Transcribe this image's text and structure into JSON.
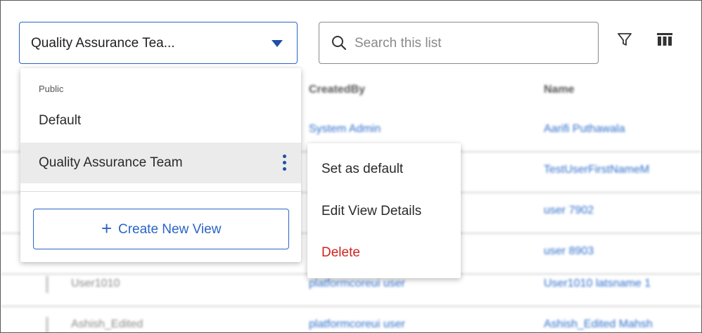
{
  "view_selector": {
    "label": "Quality Assurance Tea..."
  },
  "search": {
    "placeholder": "Search this list"
  },
  "dropdown": {
    "group_label": "Public",
    "items": [
      {
        "label": "Default"
      },
      {
        "label": "Quality Assurance Team",
        "selected": true
      }
    ],
    "create_button": {
      "icon": "+",
      "label": "Create New View"
    }
  },
  "context_menu": {
    "items": [
      {
        "label": "Set as default"
      },
      {
        "label": "Edit View Details"
      },
      {
        "label": "Delete"
      }
    ]
  },
  "table": {
    "columns": [
      "CreatedBy",
      "Name"
    ],
    "rows": [
      {
        "col1": "",
        "created_by": "System Admin",
        "name": "Aarifi Puthawala"
      },
      {
        "col1": "",
        "created_by": "",
        "name": "TestUserFirstNameM"
      },
      {
        "col1": "",
        "created_by": "",
        "name": "user 7902"
      },
      {
        "col1": "",
        "created_by": "",
        "name": "user 8903"
      },
      {
        "col1": "User1010",
        "created_by": "platformcoreui user",
        "name": "User1010 latsname 1"
      },
      {
        "col1": "Ashish_Edited",
        "created_by": "platformcoreui user",
        "name": "Ashish_Edited Mahsh"
      }
    ]
  },
  "colors": {
    "accent": "#2a64c5",
    "danger": "#d0241f",
    "selected_bg": "#ebebeb"
  }
}
